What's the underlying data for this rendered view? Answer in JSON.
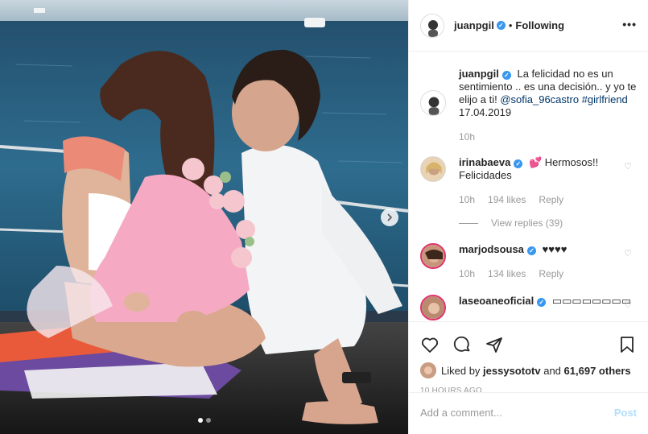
{
  "post": {
    "author": "juanpgil",
    "follow_state": "Following",
    "more_label": "•••"
  },
  "caption": {
    "username": "juanpgil",
    "text": "La felicidad no es un sentimiento .. es una decisión.. y yo te elijo a ti!",
    "mention": "@sofia_96castro",
    "hashtag": "#girlfriend",
    "date": "17.04.2019",
    "time_ago": "10h"
  },
  "comments": [
    {
      "username": "irinabaeva",
      "text": "💕 Hermosos!! Felicidades",
      "time": "10h",
      "likes": "194 likes",
      "reply": "Reply",
      "view_replies": "View replies (39)"
    },
    {
      "username": "marjodsousa",
      "text": "♥♥♥♥",
      "time": "10h",
      "likes": "134 likes",
      "reply": "Reply"
    },
    {
      "username": "laseoaneoficial",
      "text": "▭▭▭▭▭▭▭▭"
    }
  ],
  "liked_by": {
    "prefix": "Liked by",
    "user": "jessysototv",
    "joiner": "and",
    "others": "61,697 others"
  },
  "timestamp": "10 HOURS AGO",
  "add_comment": {
    "placeholder": "Add a comment...",
    "post_label": "Post"
  },
  "carousel": {
    "total": 2,
    "current": 1
  },
  "colors": {
    "verified": "#3897f0",
    "link": "#003569",
    "post_button": "#b2dffc"
  },
  "icons": [
    "heart-icon",
    "comment-icon",
    "share-icon",
    "bookmark-icon",
    "verified-badge-icon",
    "next-arrow-icon",
    "more-options-icon"
  ]
}
